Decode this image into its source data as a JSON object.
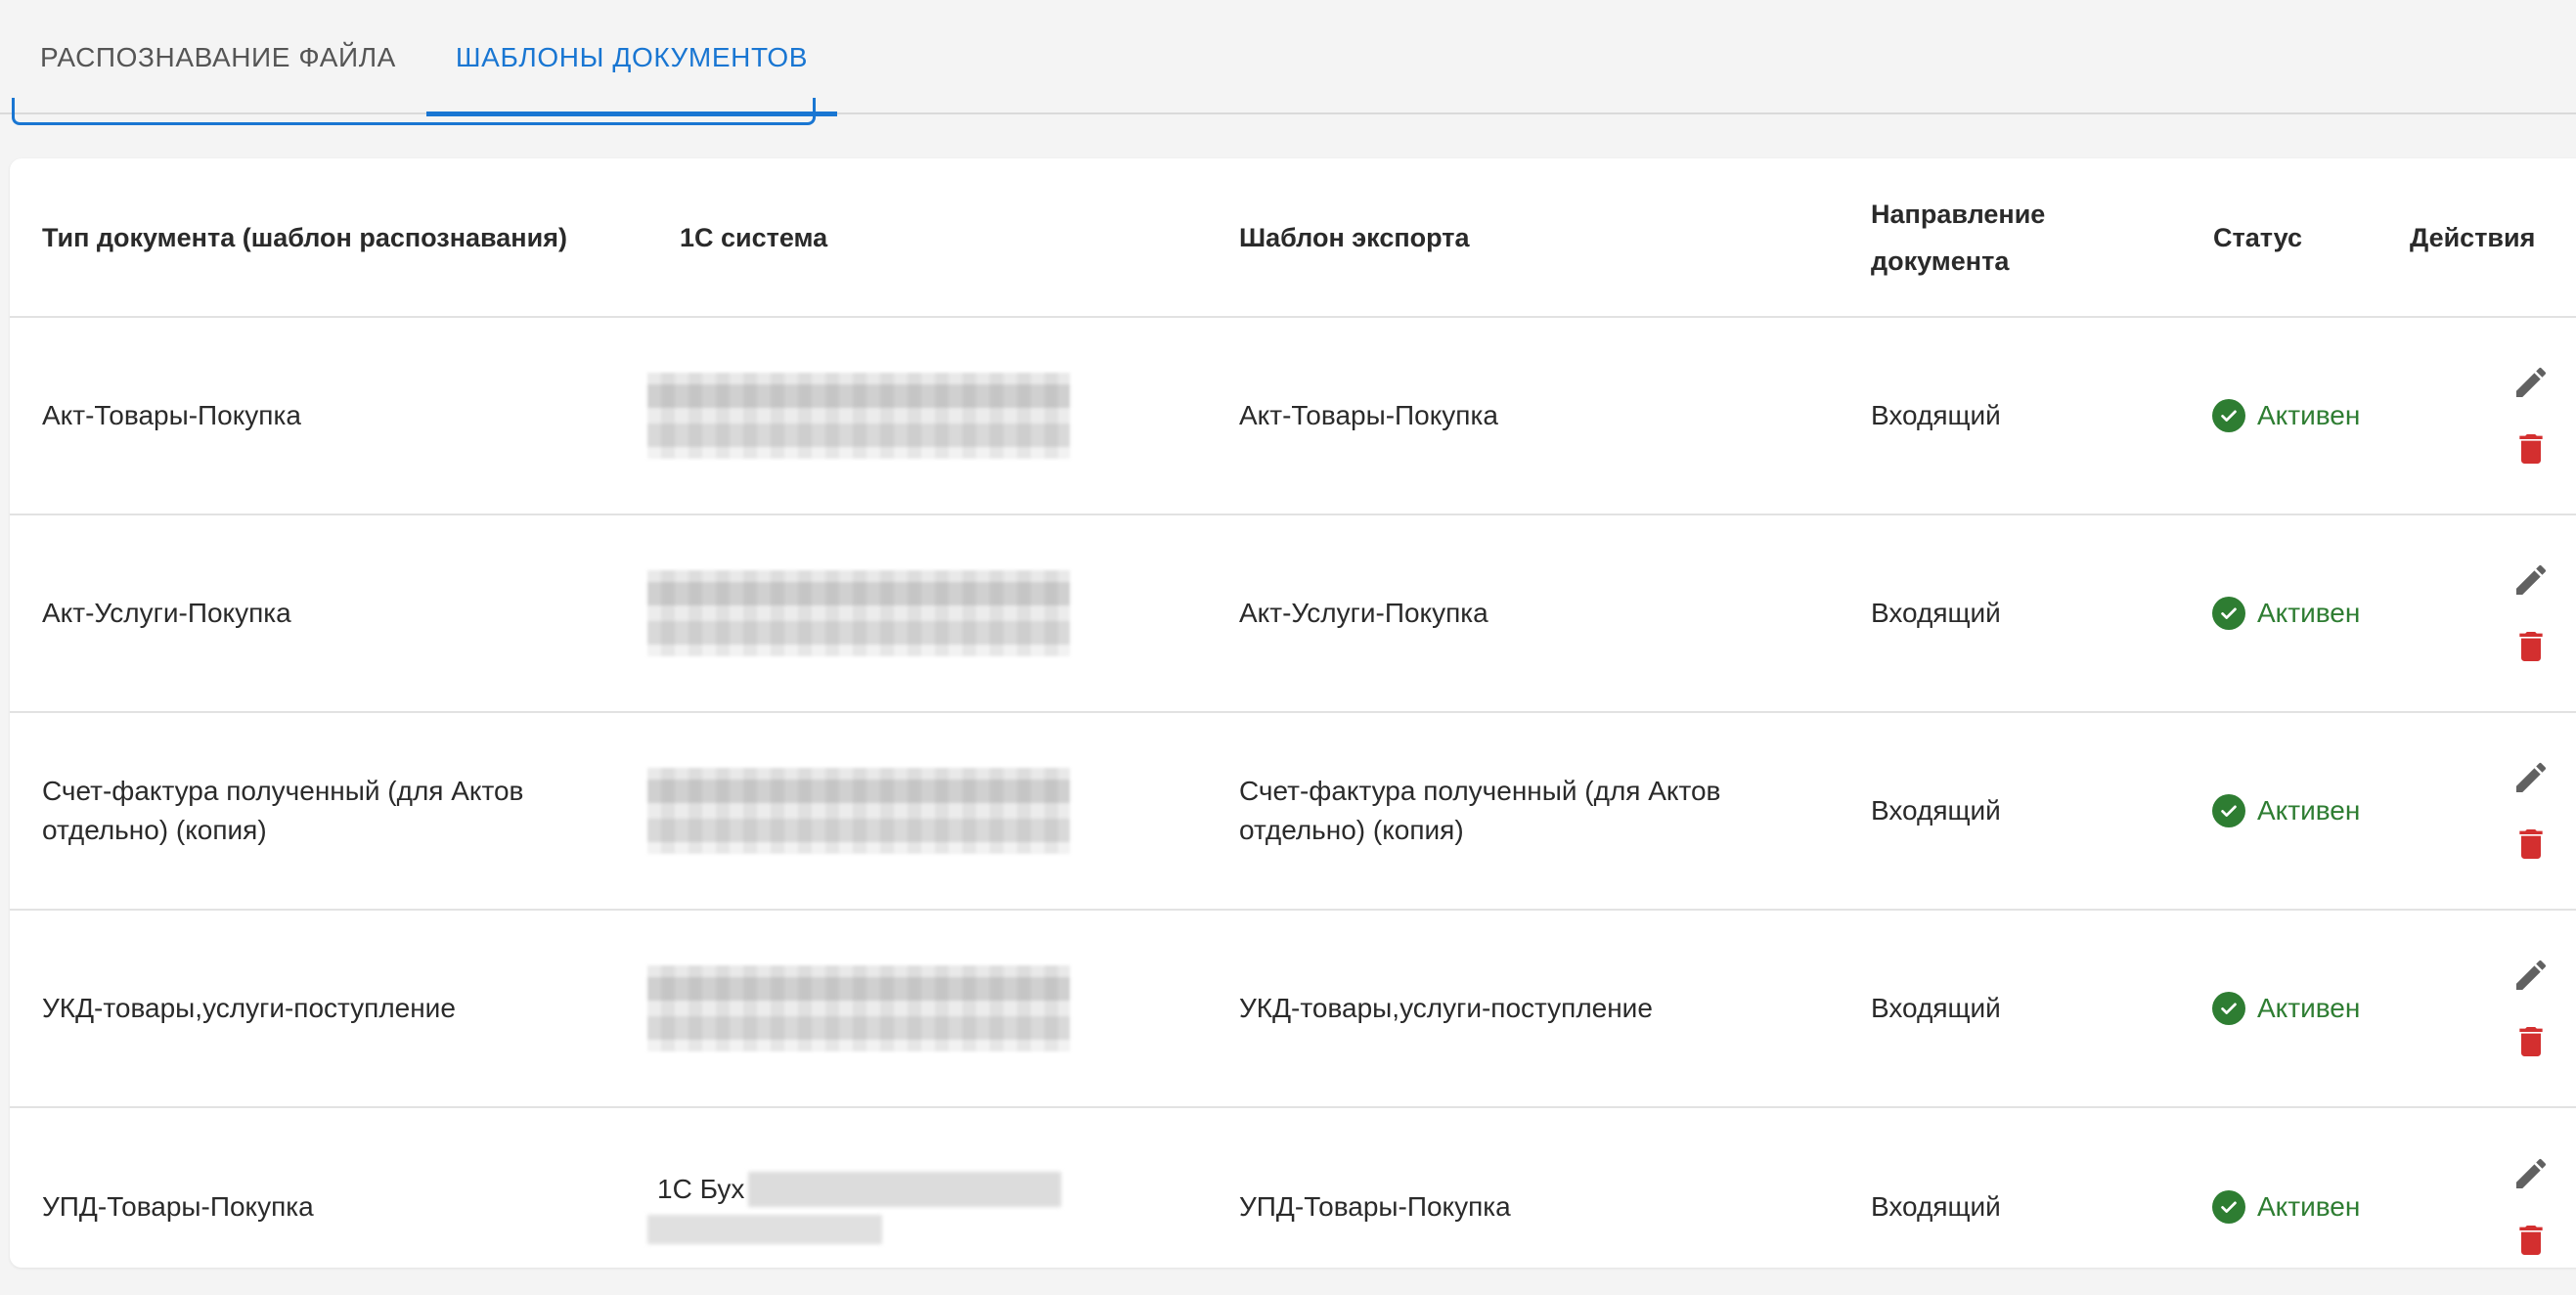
{
  "tabs": [
    {
      "label": "РАСПОЗНАВАНИЕ ФАЙЛА",
      "active": false
    },
    {
      "label": "ШАБЛОНЫ ДОКУМЕНТОВ",
      "active": true
    }
  ],
  "colors": {
    "accent": "#1976d2",
    "status_active": "#2e7d32",
    "delete": "#d32f2f",
    "edit": "#616161"
  },
  "table": {
    "headers": {
      "doc_type": "Тип документа (шаблон распознавания)",
      "system_1c": "1С система",
      "export_template": "Шаблон экспорта",
      "direction": "Направление документа",
      "status": "Статус",
      "actions": "Действия"
    },
    "rows": [
      {
        "doc_type": "Акт-Товары-Покупка",
        "system_1c_prefix": "",
        "export_template": "Акт-Товары-Покупка",
        "direction": "Входящий",
        "status": "Активен"
      },
      {
        "doc_type": "Акт-Услуги-Покупка",
        "system_1c_prefix": "",
        "export_template": "Акт-Услуги-Покупка",
        "direction": "Входящий",
        "status": "Активен"
      },
      {
        "doc_type": "Счет-фактура полученный (для Актов отдельно) (копия)",
        "system_1c_prefix": "",
        "export_template": "Счет-фактура полученный (для Актов отдельно) (копия)",
        "direction": "Входящий",
        "status": "Активен"
      },
      {
        "doc_type": "УКД-товары,услуги-поступление",
        "system_1c_prefix": "",
        "export_template": "УКД-товары,услуги-поступление",
        "direction": "Входящий",
        "status": "Активен"
      },
      {
        "doc_type": "УПД-Товары-Покупка",
        "system_1c_prefix": "1С Бух",
        "export_template": "УПД-Товары-Покупка",
        "direction": "Входящий",
        "status": "Активен"
      }
    ],
    "row_icons": {
      "status": "check-circle-icon",
      "edit": "pencil-icon",
      "delete": "trash-icon"
    }
  }
}
